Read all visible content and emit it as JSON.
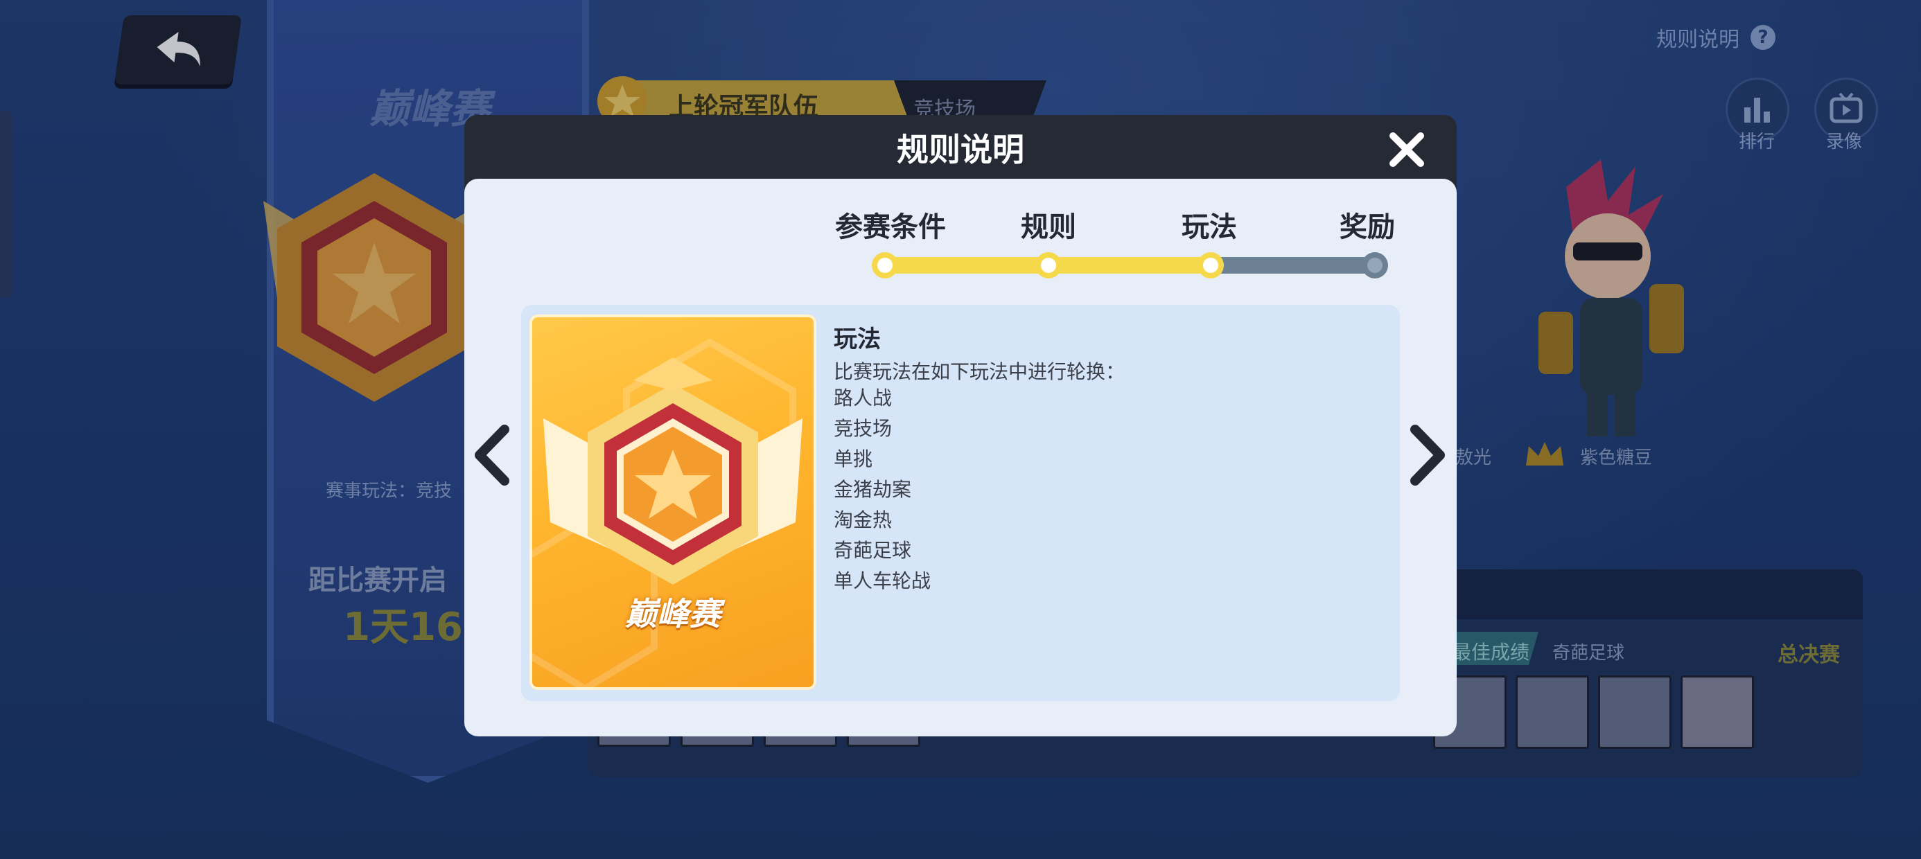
{
  "background": {
    "banner": {
      "title": "巅峰赛",
      "mode_label": "赛事玩法：竞技",
      "countdown_label": "距比赛开启",
      "countdown_value": "1天16"
    },
    "champion_bar": {
      "label": "上轮冠军队伍",
      "arena": "竞技场"
    },
    "rules_link": "规则说明",
    "top_icons": [
      {
        "label": "排行",
        "icon": "bar-chart-icon"
      },
      {
        "label": "录像",
        "icon": "tv-icon"
      }
    ],
    "names": [
      "敖光",
      "紫色糖豆"
    ],
    "lower_panel": {
      "best_label": "最佳成绩",
      "mode": "奇葩足球",
      "finals": "总决赛"
    }
  },
  "modal": {
    "title": "规则说明",
    "steps": [
      {
        "label": "参赛条件",
        "done": true
      },
      {
        "label": "规则",
        "done": true
      },
      {
        "label": "玩法",
        "done": true
      },
      {
        "label": "奖励",
        "done": false
      }
    ],
    "active_step": "玩法",
    "card_title": "巅峰赛",
    "content": {
      "title": "玩法",
      "description": "比赛玩法在如下玩法中进行轮换：",
      "modes": [
        "路人战",
        "竞技场",
        "单挑",
        "金猪劫案",
        "淘金热",
        "奇葩足球",
        "单人车轮战"
      ]
    }
  },
  "colors": {
    "accent_yellow": "#f5d94a",
    "modal_header": "#262a35",
    "modal_body": "#e7eef8"
  }
}
